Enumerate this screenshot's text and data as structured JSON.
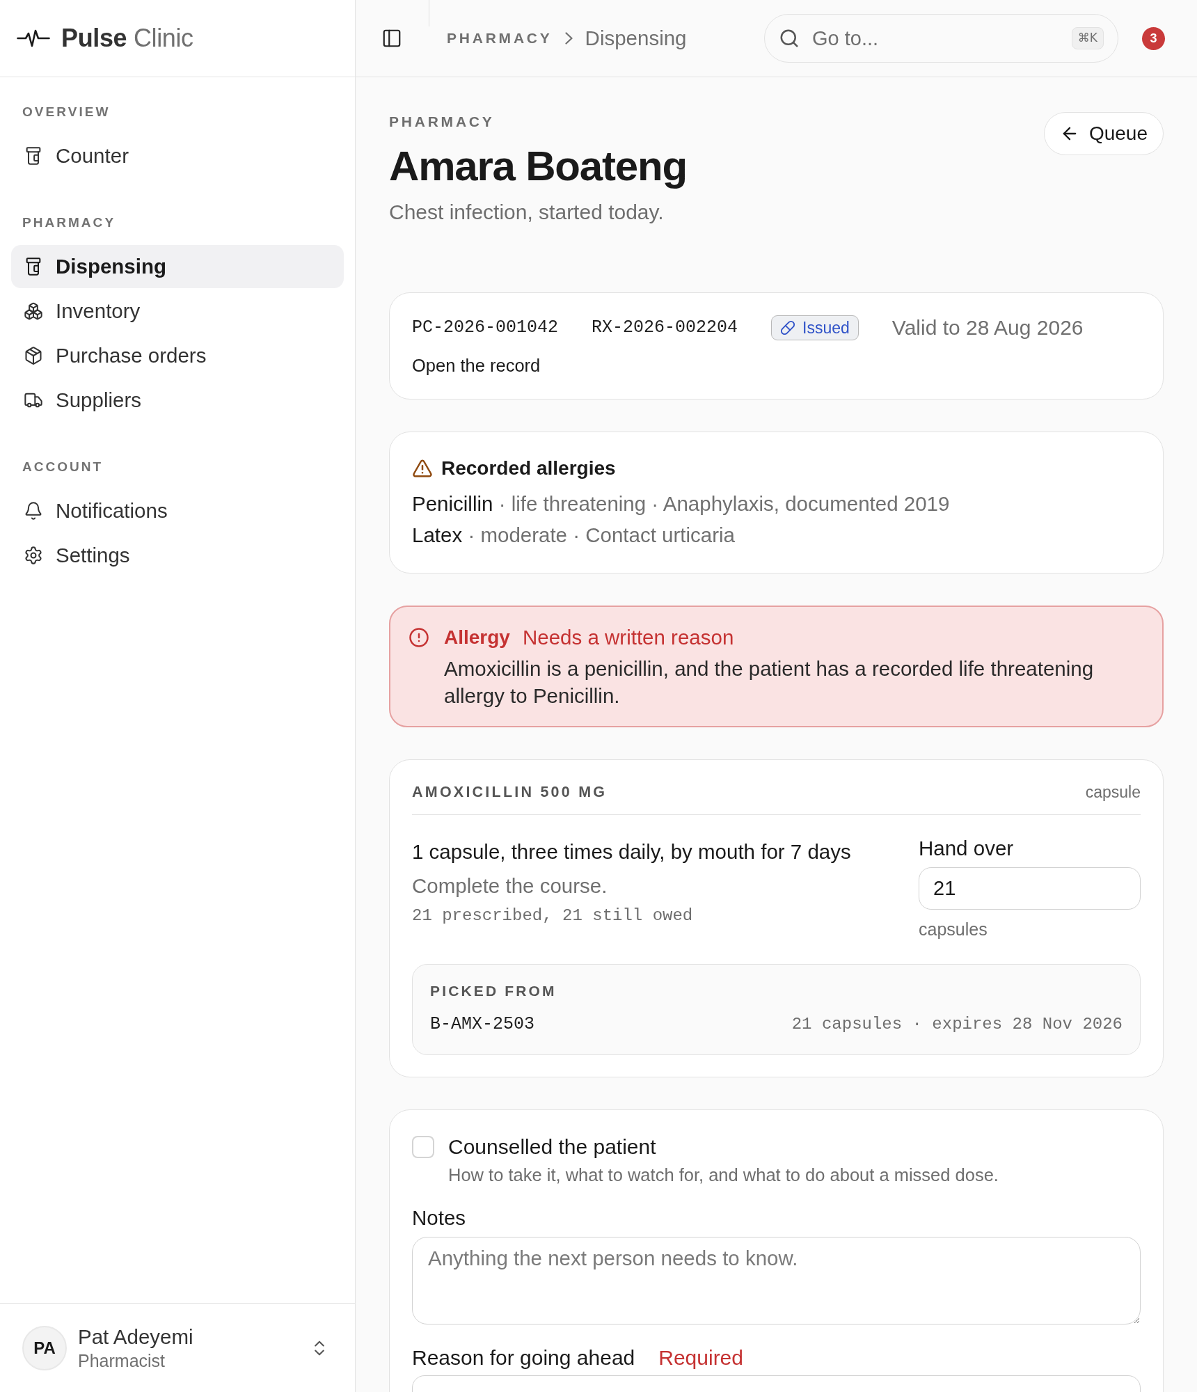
{
  "sidebar": {
    "brand": "**Pulse** Clinic",
    "sections": [
      {
        "label": "OVERVIEW",
        "items": [
          {
            "label": "Counter",
            "selected": false
          }
        ]
      },
      {
        "label": "PHARMACY",
        "items": [
          {
            "label": "Dispensing",
            "selected": true
          },
          {
            "label": "Inventory",
            "selected": false
          },
          {
            "label": "Purchase orders",
            "selected": false
          },
          {
            "label": "Suppliers",
            "selected": false
          }
        ]
      },
      {
        "label": "ACCOUNT",
        "items": [
          {
            "label": "Notifications",
            "selected": false
          },
          {
            "label": "Settings",
            "selected": false
          }
        ]
      }
    ],
    "user": {
      "initials": "PA",
      "name": "Pat Adeyemi",
      "role": "Pharmacist"
    }
  },
  "topbar": {
    "breadcrumb": [
      "PHARMACY",
      "Dispensing"
    ],
    "search": {
      "placeholder": "Go to...",
      "shortcut": "⌘K"
    },
    "notification_count": "3"
  },
  "header": {
    "eyebrow": "PHARMACY",
    "title": "Amara Boateng",
    "subtitle": "Chest infection, started today.",
    "back_button": "Queue"
  },
  "prescription": {
    "patient_id": "PC-2026-001042",
    "prescription_id": "RX-2026-002204",
    "status": "Issued",
    "validity": "Valid to 28 Aug 2026",
    "record_link": "Open the record"
  },
  "allergies": {
    "title": "Recorded allergies",
    "items": [
      {
        "substance": "Penicillin",
        "details": "· life threatening · Anaphylaxis, documented 2019"
      },
      {
        "substance": "Latex",
        "details": "· moderate · Contact urticaria"
      }
    ]
  },
  "alert": {
    "title": "Allergy",
    "status": "Needs a written reason",
    "message": "Amoxicillin is a penicillin, and the patient has a recorded life threatening allergy to Penicillin."
  },
  "medication": {
    "name": "AMOXICILLIN 500 MG",
    "form": "capsule",
    "directions": "1 capsule, three times daily, by mouth for 7 days",
    "instruction": "Complete the course.",
    "quantity_note": "21 prescribed, 21 still owed",
    "hand_over": {
      "label": "Hand over",
      "value": "21",
      "unit": "capsules"
    },
    "picked_from": {
      "label": "PICKED FROM",
      "batch": "B-AMX-2503",
      "details": "21 capsules · expires 28 Nov 2026"
    }
  },
  "counselling": {
    "label": "Counselled the patient",
    "hint": "How to take it, what to watch for, and what to do about a missed dose.",
    "checked": false,
    "notes": {
      "label": "Notes",
      "placeholder": "Anything the next person needs to know."
    },
    "reason": {
      "label": "Reason for going ahead",
      "required": "Required"
    }
  }
}
